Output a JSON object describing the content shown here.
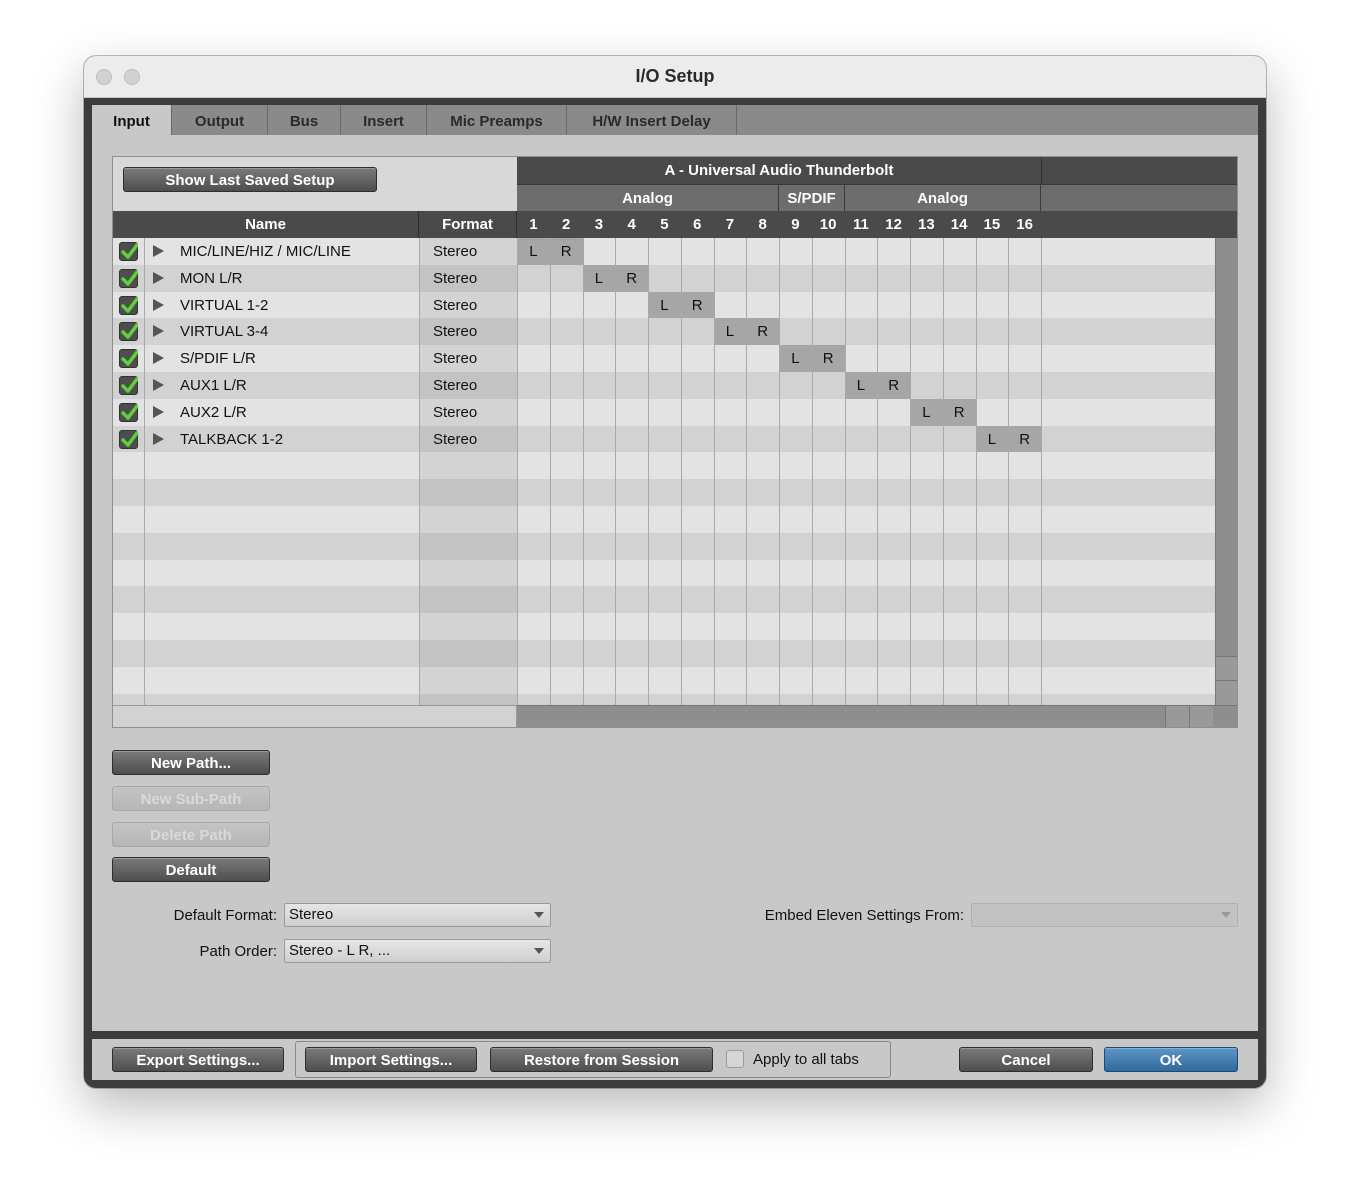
{
  "window": {
    "title": "I/O Setup"
  },
  "tabs": [
    {
      "label": "Input"
    },
    {
      "label": "Output"
    },
    {
      "label": "Bus"
    },
    {
      "label": "Insert"
    },
    {
      "label": "Mic Preamps"
    },
    {
      "label": "H/W Insert Delay"
    }
  ],
  "grid": {
    "show_last_saved_label": "Show Last Saved Setup",
    "device_name": "A - Universal Audio Thunderbolt",
    "groups": [
      {
        "label": "Analog"
      },
      {
        "label": "S/PDIF"
      },
      {
        "label": "Analog"
      }
    ],
    "col_name": "Name",
    "col_format": "Format",
    "channels": [
      "1",
      "2",
      "3",
      "4",
      "5",
      "6",
      "7",
      "8",
      "9",
      "10",
      "11",
      "12",
      "13",
      "14",
      "15",
      "16"
    ],
    "rows": [
      {
        "name": "MIC/LINE/HIZ / MIC/LINE",
        "format": "Stereo",
        "l": "L",
        "r": "R"
      },
      {
        "name": "MON L/R",
        "format": "Stereo",
        "l": "L",
        "r": "R"
      },
      {
        "name": "VIRTUAL 1-2",
        "format": "Stereo",
        "l": "L",
        "r": "R"
      },
      {
        "name": "VIRTUAL 3-4",
        "format": "Stereo",
        "l": "L",
        "r": "R"
      },
      {
        "name": "S/PDIF L/R",
        "format": "Stereo",
        "l": "L",
        "r": "R"
      },
      {
        "name": "AUX1 L/R",
        "format": "Stereo",
        "l": "L",
        "r": "R"
      },
      {
        "name": "AUX2 L/R",
        "format": "Stereo",
        "l": "L",
        "r": "R"
      },
      {
        "name": "TALKBACK 1-2",
        "format": "Stereo",
        "l": "L",
        "r": "R"
      }
    ]
  },
  "buttons": {
    "new_path": "New Path...",
    "new_sub_path": "New Sub-Path",
    "delete_path": "Delete Path",
    "default": "Default"
  },
  "settings": {
    "default_format_label": "Default Format:",
    "default_format_value": "Stereo",
    "path_order_label": "Path Order:",
    "path_order_value": "Stereo - L R, ...",
    "embed_label": "Embed Eleven Settings From:",
    "embed_value": ""
  },
  "footer": {
    "export": "Export Settings...",
    "import": "Import Settings...",
    "restore": "Restore from Session",
    "apply_all": "Apply to all tabs",
    "cancel": "Cancel",
    "ok": "OK"
  },
  "colors": {
    "ok_blue": "#3f7fb5",
    "check_green": "#5fd13a"
  }
}
